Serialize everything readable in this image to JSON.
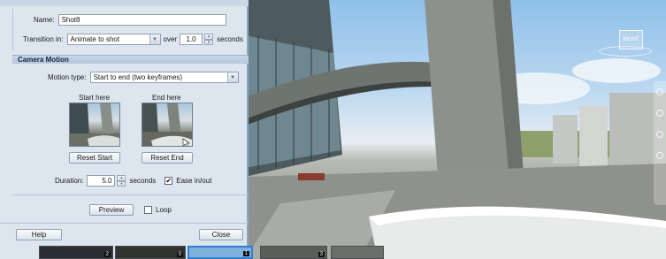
{
  "shot": {
    "name_label": "Name:",
    "name_value": "Shot8",
    "transition_label": "Transition in:",
    "transition_value": "Animate to shot",
    "over_label": "over",
    "over_value": "1.0",
    "seconds_label": "seconds"
  },
  "camera_motion": {
    "section_title": "Camera Motion",
    "motion_type_label": "Motion type:",
    "motion_type_value": "Start to end (two keyframes)",
    "start_label": "Start here",
    "end_label": "End here",
    "reset_start": "Reset Start",
    "reset_end": "Reset End",
    "duration_label": "Duration:",
    "duration_value": "5.0",
    "duration_unit": "seconds",
    "ease_label": "Ease in/out",
    "ease_checked": true,
    "preview": "Preview",
    "loop_label": "Loop",
    "loop_checked": false
  },
  "footer": {
    "help": "Help",
    "close": "Close"
  },
  "viewport": {
    "nav_cube_label": "RIGHT"
  },
  "filmstrip": {
    "numbers": [
      "2",
      "0",
      "1",
      "3"
    ]
  }
}
